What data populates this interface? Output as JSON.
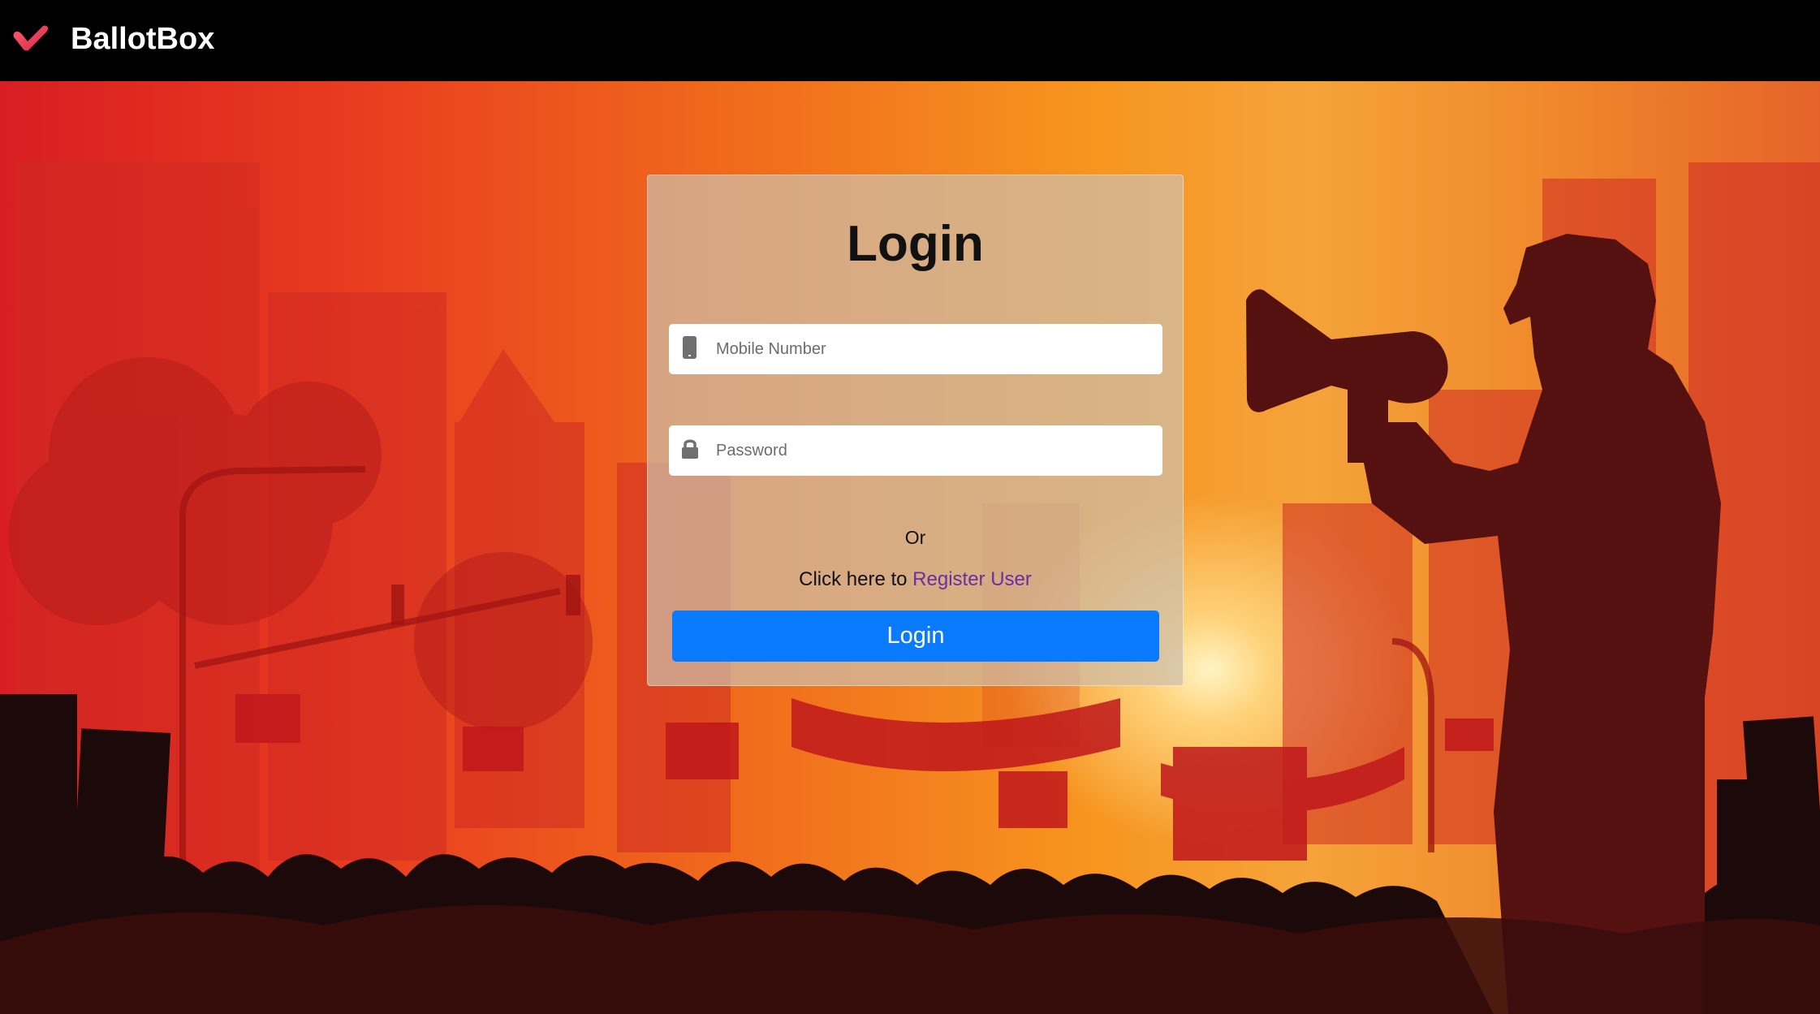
{
  "navbar": {
    "brand_name": "BallotBox",
    "brand_icon": "check-heart-icon",
    "brand_color": "#e83a55"
  },
  "login_form": {
    "title": "Login",
    "mobile_field": {
      "icon": "mobile-phone-icon",
      "placeholder": "Mobile Number",
      "value": ""
    },
    "password_field": {
      "icon": "lock-icon",
      "placeholder": "Password",
      "value": ""
    },
    "or_text": "Or",
    "register_prefix": "Click here to ",
    "register_link": "Register User",
    "submit_label": "Login",
    "submit_color": "#0a7bff"
  },
  "background": {
    "description_colors": [
      "#d81e22",
      "#f06a1c",
      "#f7951f",
      "#ffd27a"
    ]
  }
}
